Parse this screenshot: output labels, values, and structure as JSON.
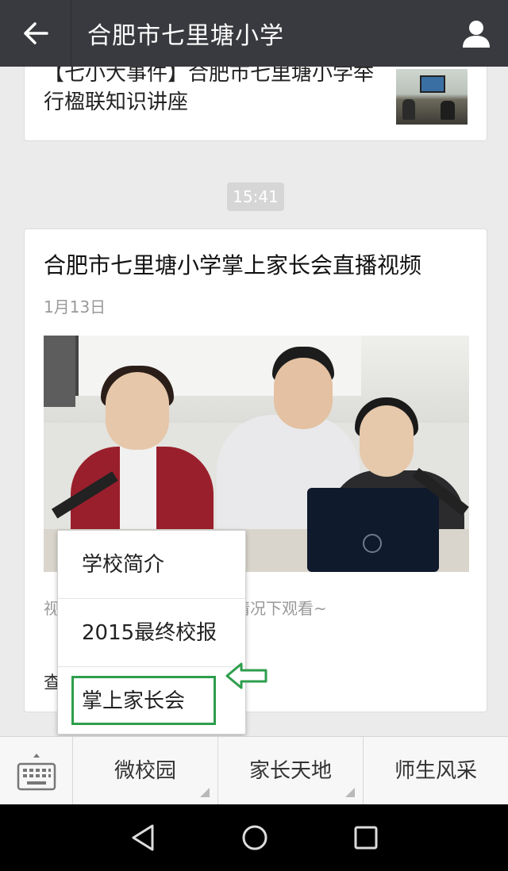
{
  "header": {
    "title": "合肥市七里塘小学"
  },
  "messages": {
    "prev_article_title": "【七小大事件】合肥市七里塘小学举行楹联知识讲座",
    "time": "15:41",
    "article": {
      "title": "合肥市七里塘小学掌上家长会直播视频",
      "date": "1月13日",
      "desc_start": "视",
      "desc_end": "情况下观看~",
      "read_more": "查"
    }
  },
  "popup_menu": {
    "items": [
      "学校简介",
      "2015最终校报",
      "掌上家长会"
    ],
    "highlight_color": "#2e9e4c"
  },
  "menu_bar": {
    "tabs": [
      "微校园",
      "家长天地",
      "师生风采"
    ]
  },
  "colors": {
    "topbar": "#393a3f",
    "highlight": "#2e9e4c"
  }
}
